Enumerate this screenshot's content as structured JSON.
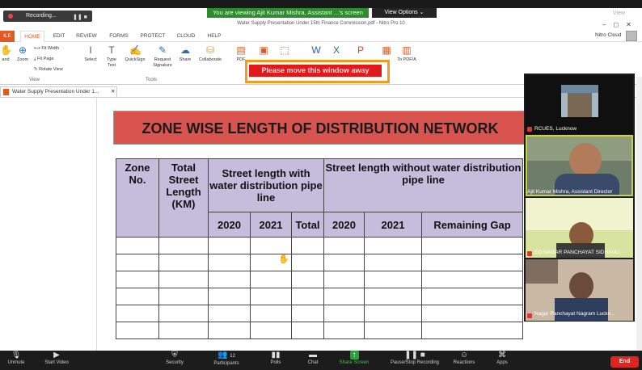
{
  "zoom": {
    "viewing_banner": "You are viewing Ajit  Kumar Mishra, Assistant ...'s screen",
    "view_options": "View Options ⌄",
    "recording": "Recording...",
    "view_label": "View"
  },
  "window": {
    "title": "Water Supply Presentation Under 15th Finance Commission.pdf - Nitro Pro 10"
  },
  "ribbon": {
    "tabs": [
      "ILE",
      "HOME",
      "EDIT",
      "REVIEW",
      "FORMS",
      "PROTECT",
      "CLOUD",
      "HELP"
    ],
    "nitro_cloud": "Nitro Cloud",
    "fit_width": "Fit Width",
    "fit_page": "Fit Page",
    "rotate_view": "Rotate View",
    "hand": "and",
    "zoom": "Zoom",
    "select": "Select",
    "type_text": "Type Text",
    "quicksign": "QuickSign",
    "request_signature": "Request Signature",
    "share": "Share",
    "collaborate": "Collaborate",
    "pdf": "PDF",
    "to_pdfa": "To PDF/A",
    "group_view": "View",
    "group_tools": "Tools"
  },
  "popup": {
    "text": "Please move this window away"
  },
  "doc_tab": {
    "label": "Water Supply Presentation Under 1..."
  },
  "slide": {
    "title": "ZONE WISE LENGTH OF DISTRIBUTION NETWORK",
    "table": {
      "h_zone": "Zone No.",
      "h_total": "Total Street Length (KM)",
      "h_with": "Street length with water distribution pipe line",
      "h_without": "Street length without water distribution pipe line",
      "sub": [
        "2020",
        "2021",
        "Total",
        "2020",
        "2021",
        "Remaining Gap"
      ]
    }
  },
  "participants": [
    {
      "name": "RCUES, Lucknow"
    },
    {
      "name": "Ajit  Kumar Mishra, Assistant Director"
    },
    {
      "name": "EO NAGAR PANCHAYAT SIDHAULI"
    },
    {
      "name": "Nagar Panchayat Nagram Luckn..."
    }
  ],
  "toolbar": {
    "unmute": "Unmute",
    "start_video": "Start Video",
    "security": "Security",
    "participants": "Participants",
    "participants_count": "12",
    "polls": "Polls",
    "chat": "Chat",
    "share_screen": "Share Screen",
    "pause_recording": "Pause/Stop Recording",
    "reactions": "Reactions",
    "apps": "Apps",
    "end": "End"
  }
}
